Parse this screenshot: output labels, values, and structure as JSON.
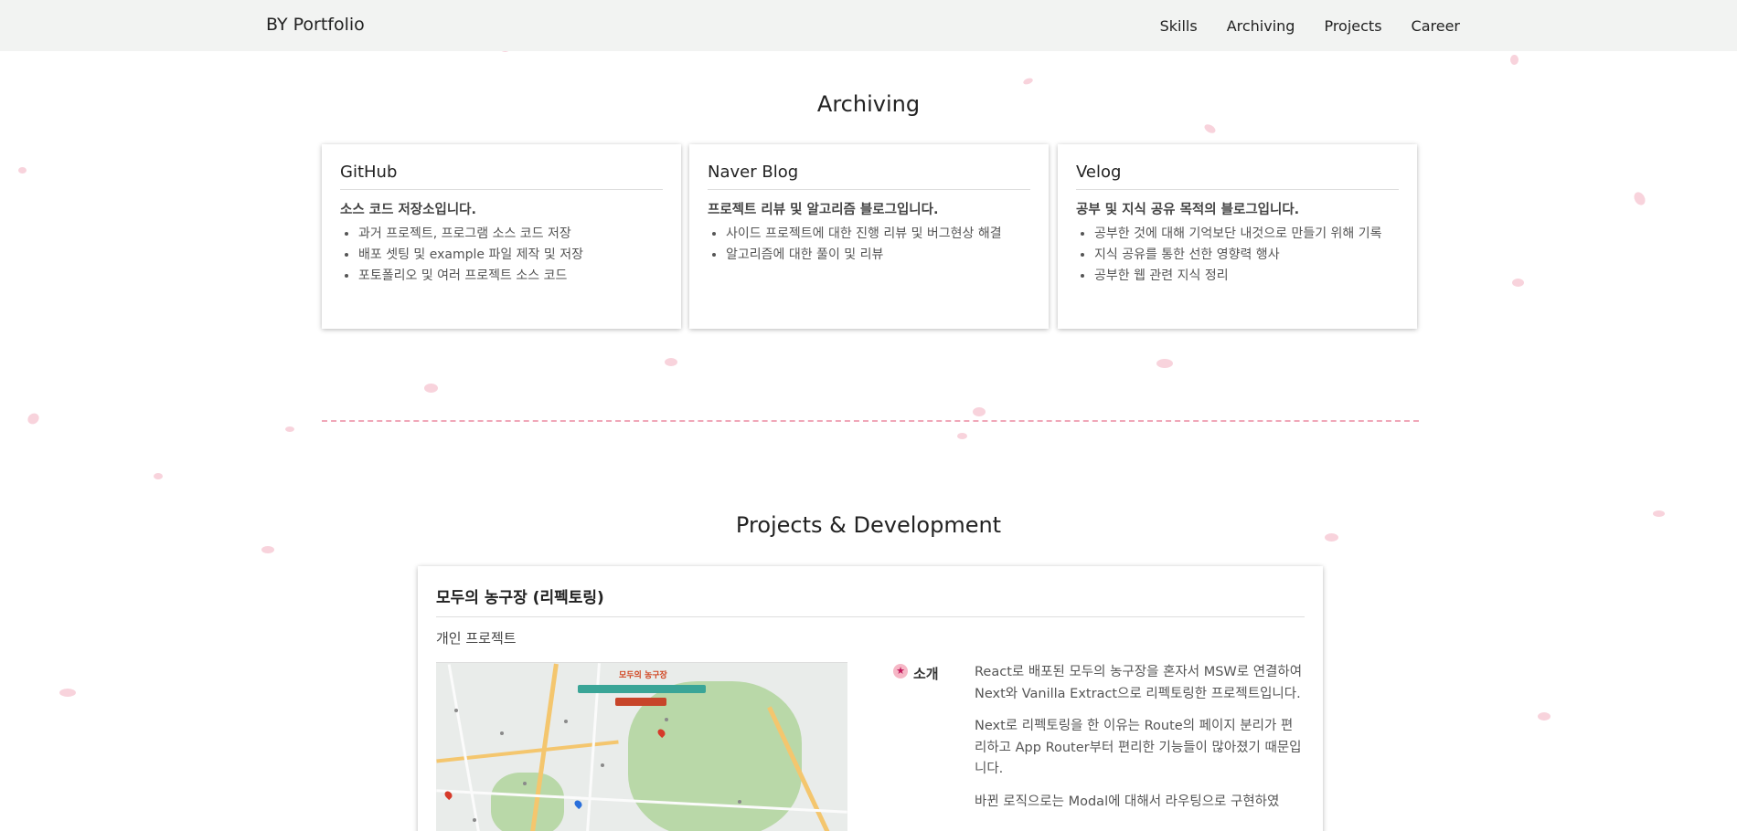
{
  "navbar": {
    "brand": "BY Portfolio",
    "links": [
      "Skills",
      "Archiving",
      "Projects",
      "Career"
    ]
  },
  "archiving": {
    "title": "Archiving",
    "cards": [
      {
        "title": "GitHub",
        "description": "소스 코드 저장소입니다.",
        "items": [
          "과거 프로젝트, 프로그램 소스 코드 저장",
          "배포 셋팅 및 example 파일 제작 및 저장",
          "포토폴리오 및 여러 프로젝트 소스 코드"
        ]
      },
      {
        "title": "Naver Blog",
        "description": "프로젝트 리뷰 및 알고리즘 블로그입니다.",
        "items": [
          "사이드 프로젝트에 대한 진행 리뷰 및 버그현상 해결",
          "알고리즘에 대한 풀이 및 리뷰"
        ]
      },
      {
        "title": "Velog",
        "description": "공부 및 지식 공유 목적의 블로그입니다.",
        "items": [
          "공부한 것에 대해 기억보단 내것으로 만들기 위해 기록",
          "지식 공유를 통한 선한 영향력 행사",
          "공부한 웹 관련 지식 정리"
        ]
      }
    ]
  },
  "projects": {
    "title": "Projects & Development",
    "items": [
      {
        "title": "모두의 농구장 (리펙토링)",
        "type": "개인 프로젝트",
        "screenshot_logo": "모두의 농구장",
        "intro_label": "소개",
        "intro_icon": "star-icon",
        "paragraphs": [
          "React로 배포된 모두의 농구장을 혼자서 MSW로 연결하여 Next와 Vanilla Extract으로 리펙토링한 프로젝트입니다.",
          "Next로 리펙토링을 한 이유는 Route의 페이지 분리가 편리하고 App Router부터 편리한 기능들이 많아졌기 때문입니다.",
          "바뀐 로직으로는 Modal에 대해서 라우팅으로 구현하였"
        ]
      }
    ]
  },
  "colors": {
    "navbar_bg": "#f2f3f2",
    "petal": "#f8d3dc",
    "divider": "#f0a7b8"
  }
}
